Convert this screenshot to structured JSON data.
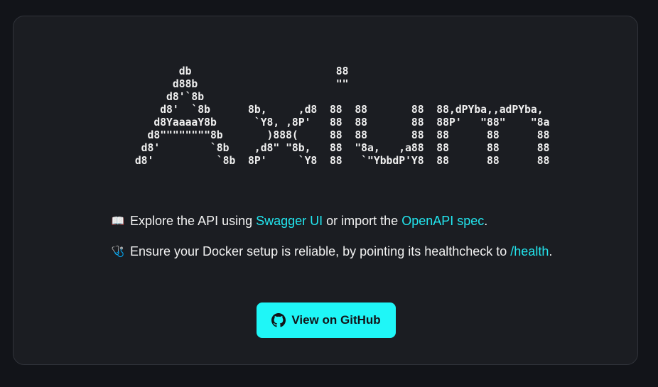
{
  "ascii_logo": [
    "        db                       88",
    "       d88b                      \"\"",
    "      d8'`8b",
    "     d8'  `8b      8b,     ,d8  88  88       88  88,dPYba,,adPYba,",
    "    d8YaaaaY8b      `Y8, ,8P'   88  88       88  88P'   \"88\"    \"8a",
    "   d8\"\"\"\"\"\"\"\"8b       )888(     88  88       88  88      88      88",
    "  d8'        `8b    ,d8\" \"8b,   88  \"8a,   ,a88  88      88      88",
    " d8'          `8b  8P'     `Y8  88   `\"YbbdP'Y8  88      88      88"
  ],
  "explore": {
    "emoji": "📖",
    "prefix": "Explore the API using ",
    "swagger_link": "Swagger UI",
    "middle": " or import the ",
    "openapi_link": "OpenAPI spec",
    "suffix": "."
  },
  "health": {
    "emoji": "🩺",
    "prefix": "Ensure your Docker setup is reliable, by pointing its healthcheck to ",
    "health_link": "/health",
    "suffix": "."
  },
  "github_button": {
    "label": "View on GitHub",
    "icon": "github-icon"
  },
  "colors": {
    "background": "#121419",
    "card": "#1b1d22",
    "accent": "#22e6ef",
    "button": "#1ff6f7"
  }
}
